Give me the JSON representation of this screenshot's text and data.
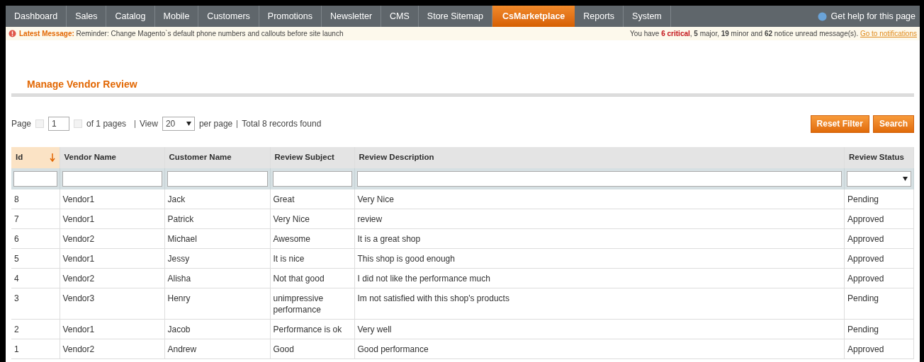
{
  "nav": {
    "items": [
      {
        "label": "Dashboard",
        "selected": false
      },
      {
        "label": "Sales",
        "selected": false
      },
      {
        "label": "Catalog",
        "selected": false
      },
      {
        "label": "Mobile",
        "selected": false
      },
      {
        "label": "Customers",
        "selected": false
      },
      {
        "label": "Promotions",
        "selected": false
      },
      {
        "label": "Newsletter",
        "selected": false
      },
      {
        "label": "CMS",
        "selected": false
      },
      {
        "label": "Store Sitemap",
        "selected": false
      },
      {
        "label": "CsMarketplace",
        "selected": true
      },
      {
        "label": "Reports",
        "selected": false
      },
      {
        "label": "System",
        "selected": false
      }
    ],
    "help": "Get help for this page"
  },
  "message_bar": {
    "label": "Latest Message:",
    "text": "Reminder: Change Magento`s default phone numbers and callouts before site launch",
    "notice": [
      {
        "kind": "plain",
        "text": "You have "
      },
      {
        "kind": "critical",
        "text": "6 critical"
      },
      {
        "kind": "plain",
        "text": ", "
      },
      {
        "kind": "bold",
        "text": "5"
      },
      {
        "kind": "plain",
        "text": " major, "
      },
      {
        "kind": "bold",
        "text": "19"
      },
      {
        "kind": "plain",
        "text": " minor and "
      },
      {
        "kind": "bold",
        "text": "62"
      },
      {
        "kind": "plain",
        "text": " notice unread message(s). "
      }
    ],
    "link": "Go to notifications"
  },
  "title": "Manage Vendor Review",
  "pager": {
    "page_label": "Page",
    "page": "1",
    "of_pages": "of 1 pages",
    "view_label": "View",
    "per_page": "20",
    "per_page_label": "per page",
    "total": "Total 8 records found"
  },
  "buttons": [
    "Reset Filter",
    "Search"
  ],
  "table": {
    "columns": [
      {
        "label": "Id",
        "sorted": true,
        "kind": "text"
      },
      {
        "label": "Vendor Name",
        "sorted": false,
        "kind": "text"
      },
      {
        "label": "Customer Name",
        "sorted": false,
        "kind": "text"
      },
      {
        "label": "Review Subject",
        "sorted": false,
        "kind": "text"
      },
      {
        "label": "Review Description",
        "sorted": false,
        "kind": "text"
      },
      {
        "label": "Review Status",
        "sorted": false,
        "kind": "select"
      }
    ],
    "rows": [
      [
        "8",
        "Vendor1",
        "Jack",
        "Great",
        "Very Nice",
        "Pending"
      ],
      [
        "7",
        "Vendor1",
        "Patrick",
        "Very Nice",
        "review",
        "Approved"
      ],
      [
        "6",
        "Vendor2",
        "Michael",
        "Awesome",
        "It is a great shop",
        "Approved"
      ],
      [
        "5",
        "Vendor1",
        "Jessy",
        "It is nice",
        "This shop is good enough",
        "Approved"
      ],
      [
        "4",
        "Vendor2",
        "Alisha",
        "Not that good",
        "I did not like the performance much",
        "Approved"
      ],
      [
        "3",
        "Vendor3",
        "Henry",
        "unimpressive performance",
        "Im not satisfied with this shop's products",
        "Pending"
      ],
      [
        "2",
        "Vendor1",
        "Jacob",
        "Performance is ok",
        "Very well",
        "Pending"
      ],
      [
        "1",
        "Vendor2",
        "Andrew",
        "Good",
        "Good performance",
        "Approved"
      ]
    ]
  }
}
